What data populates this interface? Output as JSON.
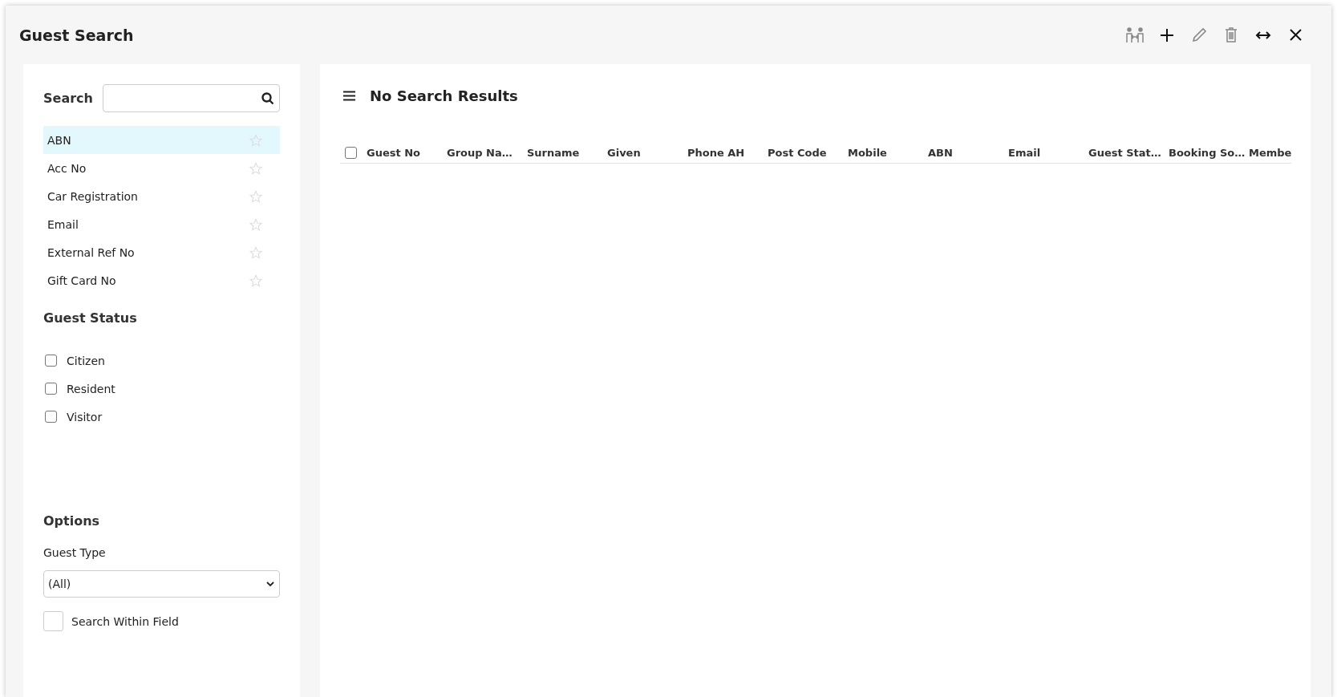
{
  "window": {
    "title": "Guest Search"
  },
  "toolbar": [
    {
      "kind": "merge",
      "disabled": true
    },
    {
      "kind": "add",
      "disabled": false
    },
    {
      "kind": "edit",
      "disabled": true
    },
    {
      "kind": "delete",
      "disabled": true
    },
    {
      "kind": "resize",
      "disabled": false
    },
    {
      "kind": "close",
      "disabled": false
    }
  ],
  "search": {
    "label": "Search"
  },
  "search_fields": [
    {
      "label": "ABN",
      "selected": true,
      "starred": false
    },
    {
      "label": "Acc No",
      "selected": false,
      "starred": false
    },
    {
      "label": "Car Registration",
      "selected": false,
      "starred": false
    },
    {
      "label": "Email",
      "selected": false,
      "starred": false
    },
    {
      "label": "External Ref No",
      "selected": false,
      "starred": false
    },
    {
      "label": "Gift Card No",
      "selected": false,
      "starred": false
    }
  ],
  "guest_status": {
    "title": "Guest Status",
    "options": [
      {
        "label": "Citizen",
        "checked": false
      },
      {
        "label": "Resident",
        "checked": false
      },
      {
        "label": "Visitor",
        "checked": false
      }
    ]
  },
  "options": {
    "title": "Options",
    "guest_type": {
      "label": "Guest Type",
      "value": "(All)"
    },
    "search_within_field": {
      "label": "Search Within Field",
      "checked": false
    }
  },
  "results": {
    "title": "No Search Results",
    "select_all_checked": false,
    "columns": [
      "Guest No",
      "Group Na…",
      "Surname",
      "Given",
      "Phone AH",
      "Post Code",
      "Mobile",
      "ABN",
      "Email",
      "Guest Stat…",
      "Booking So…",
      "Membe"
    ]
  }
}
